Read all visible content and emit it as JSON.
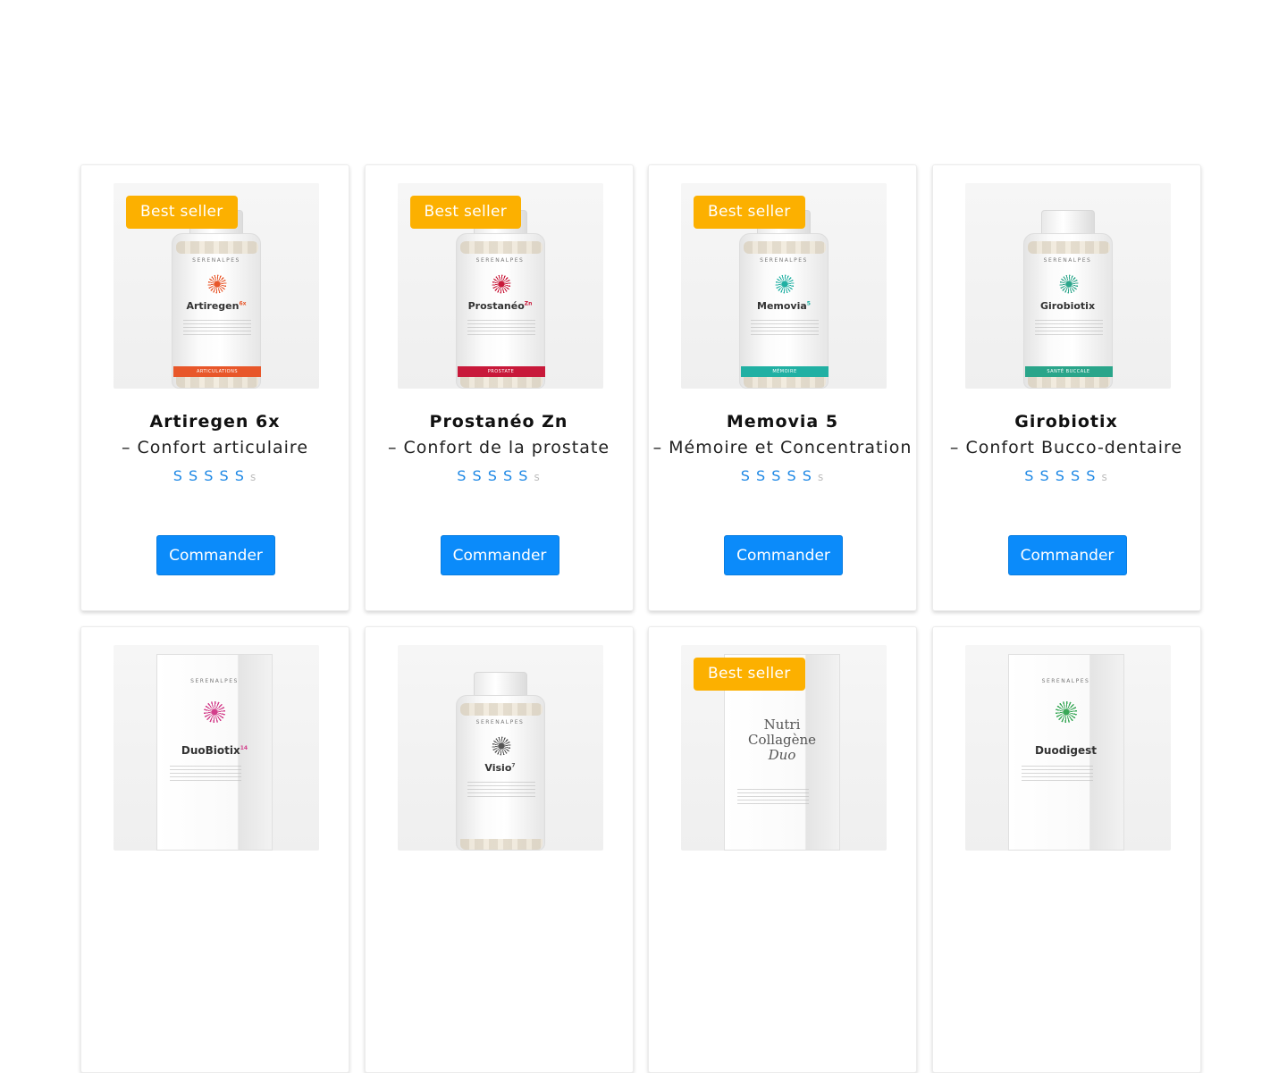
{
  "badge_label": "Best seller",
  "button_label": "Commander",
  "brand_name": "SERENALPES",
  "colors": {
    "badge": "#fcb000",
    "button": "#0b8bfa",
    "stars": "#1e88e5"
  },
  "rating_glyph": "S",
  "products": [
    {
      "name": "Artiregen 6x",
      "subtitle": "– Confort articulaire",
      "best_seller": true,
      "pack_name": "Artiregen",
      "pack_sup": "6x",
      "stripe_label": "ARTICULATIONS",
      "accent": "#e8572a",
      "type": "bottle",
      "stars": 5
    },
    {
      "name": "Prostanéo Zn",
      "subtitle": "– Confort de la prostate",
      "best_seller": true,
      "pack_name": "Prostanéo",
      "pack_sup": "Zn",
      "stripe_label": "PROSTATE",
      "accent": "#c8193a",
      "type": "bottle",
      "stars": 5
    },
    {
      "name": "Memovia 5",
      "subtitle": "– Mémoire et Concentration",
      "best_seller": true,
      "pack_name": "Memovia",
      "pack_sup": "5",
      "stripe_label": "MÉMOIRE",
      "accent": "#21b0a3",
      "type": "bottle",
      "stars": 5
    },
    {
      "name": "Girobiotix",
      "subtitle": "– Confort Bucco-dentaire",
      "best_seller": false,
      "pack_name": "Girobiotix",
      "pack_sup": "",
      "stripe_label": "SANTÉ BUCCALE",
      "accent": "#2aa58a",
      "type": "bottle",
      "stars": 5
    },
    {
      "name": "",
      "subtitle": "",
      "best_seller": false,
      "pack_name": "DuoBiotix",
      "pack_sup": "14",
      "stripe_label": "",
      "accent": "#d33f8b",
      "type": "box",
      "stars": 0
    },
    {
      "name": "",
      "subtitle": "",
      "best_seller": false,
      "pack_name": "Visio",
      "pack_sup": "7",
      "stripe_label": "",
      "accent": "#555555",
      "type": "bottle",
      "stars": 0
    },
    {
      "name": "",
      "subtitle": "",
      "best_seller": true,
      "pack_name": "Nutri Collagène Duo",
      "pack_sup": "",
      "stripe_label": "",
      "accent": "#7a7a7a",
      "type": "box-serif",
      "stars": 0
    },
    {
      "name": "",
      "subtitle": "",
      "best_seller": false,
      "pack_name": "Duodigest",
      "pack_sup": "",
      "stripe_label": "",
      "accent": "#3aa858",
      "type": "box",
      "stars": 0
    }
  ]
}
